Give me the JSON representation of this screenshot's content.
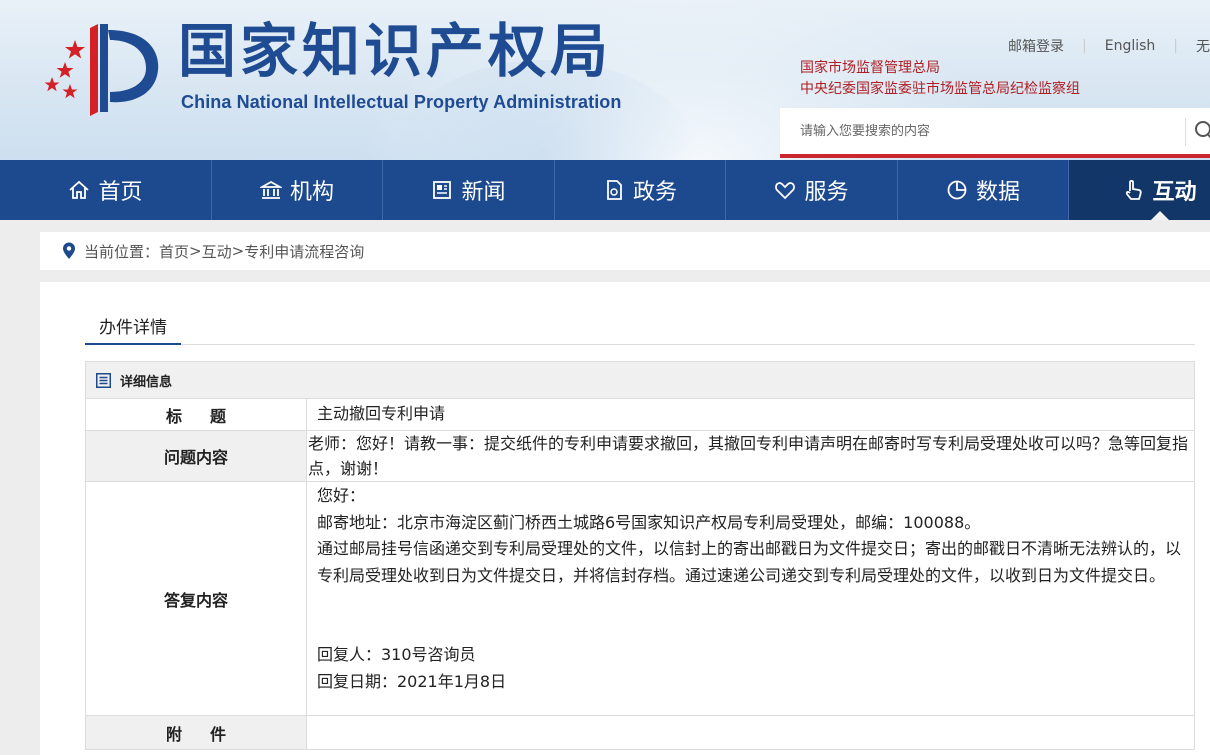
{
  "header": {
    "logo_cn": "国家知识产权局",
    "logo_en": "China National Intellectual Property Administration",
    "links": [
      "邮箱登录",
      "English",
      "无"
    ],
    "affiliations": [
      "国家市场监督管理总局",
      "中央纪委国家监委驻市场监管总局纪检监察组"
    ],
    "search_placeholder": "请输入您要搜索的内容",
    "brand_colors": {
      "blue": "#1d4a8f",
      "red": "#c9272d"
    }
  },
  "nav": {
    "items": [
      {
        "label": "首页",
        "icon": "home-icon"
      },
      {
        "label": "机构",
        "icon": "institution-icon"
      },
      {
        "label": "新闻",
        "icon": "newspaper-icon"
      },
      {
        "label": "政务",
        "icon": "document-icon"
      },
      {
        "label": "服务",
        "icon": "heart-hand-icon"
      },
      {
        "label": "数据",
        "icon": "pie-chart-icon"
      },
      {
        "label": "互动",
        "icon": "pointer-hand-icon",
        "active": true
      }
    ]
  },
  "breadcrumb": {
    "prefix": "当前位置：",
    "items": [
      "首页",
      "互动",
      "专利申请流程咨询"
    ],
    "sep": ">"
  },
  "main": {
    "tab_title": "办件详情",
    "section_title": "详细信息",
    "rows": {
      "title_label": "标题",
      "title_value": "主动撤回专利申请",
      "question_label": "问题内容",
      "question_value": "老师：您好！请教一事：提交纸件的专利申请要求撤回，其撤回专利申请声明在邮寄时写专利局受理处收可以吗？急等回复指点，谢谢！",
      "answer_label": "答复内容",
      "answer_lines": [
        "您好：",
        "邮寄地址：北京市海淀区蓟门桥西土城路6号国家知识产权局专利局受理处，邮编：100088。",
        "通过邮局挂号信函递交到专利局受理处的文件，以信封上的寄出邮戳日为文件提交日；寄出的邮戳日不清晰无法辨认的，以专利局受理处收到日为文件提交日，并将信封存档。通过速递公司递交到专利局受理处的文件，以收到日为文件提交日。",
        "",
        "",
        "回复人：310号咨询员",
        "回复日期：2021年1月8日"
      ],
      "attachment_label": "附件"
    }
  }
}
